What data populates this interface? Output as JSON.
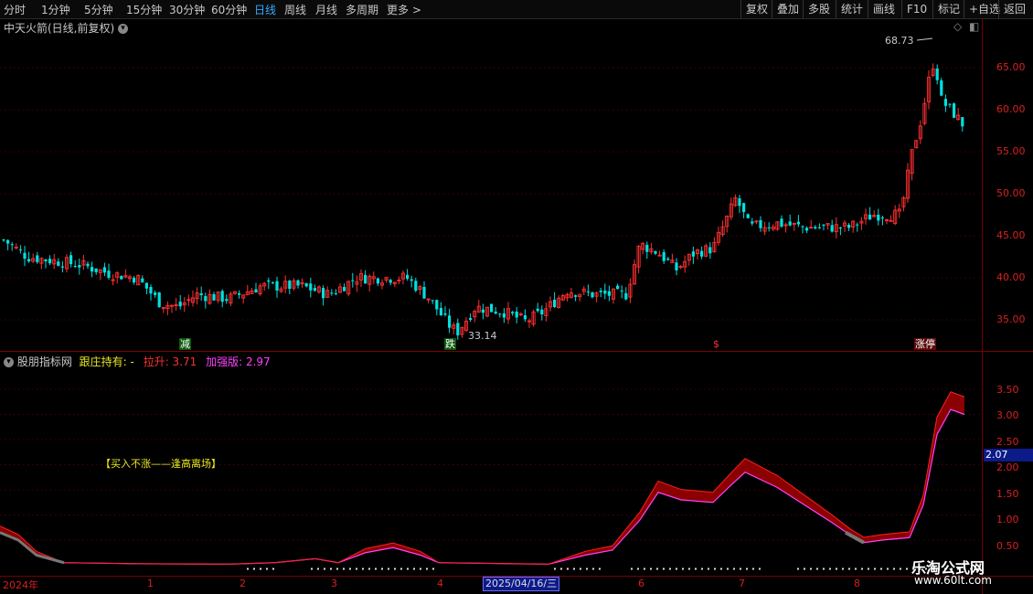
{
  "toolbar": {
    "tabs": [
      "分时",
      "1分钟",
      "5分钟",
      "15分钟",
      "30分钟",
      "60分钟",
      "日线",
      "周线",
      "月线",
      "多周期",
      "更多 >"
    ],
    "active_tab": "日线",
    "right_buttons": [
      "复权",
      "叠加",
      "多股",
      "统计",
      "画线",
      "F10",
      "标记",
      "+自选",
      "返回"
    ]
  },
  "main_chart": {
    "title": "中天火箭(日线,前复权)",
    "price_axis": [
      "65.00",
      "60.00",
      "55.00",
      "50.00",
      "45.00",
      "40.00",
      "35.00"
    ],
    "high_label": "68.73",
    "low_label": "33.14",
    "signals": [
      {
        "text": "减",
        "color": "#00c040"
      },
      {
        "text": "跌",
        "color": "#00c040"
      },
      {
        "text": "$",
        "color": "#ff3030"
      },
      {
        "text": "涨停",
        "color": "#ff4040"
      }
    ]
  },
  "indicator": {
    "name": "股朋指标网",
    "line1_label": "跟庄持有: -",
    "line2_label": "拉升: 3.71",
    "line3_label": "加强版: 2.97",
    "axis": [
      "3.50",
      "3.00",
      "2.50",
      "2.00",
      "1.50",
      "1.00",
      "0.50"
    ],
    "cursor_value": "2.07",
    "note": "【买入不涨——逢高离场】"
  },
  "date_axis": {
    "labels": [
      "2024年",
      "1",
      "2",
      "3",
      "4",
      "6",
      "7",
      "8"
    ],
    "cursor_date": "2025/04/16/三"
  },
  "watermark": {
    "line1": "乐淘公式网",
    "line2": "www.60lt.com"
  },
  "colors": {
    "up": "#ff3030",
    "down": "#00e0e0",
    "indicator_fill": "#8b0000",
    "indicator_line": "#ff40ff",
    "grid": "#7a0000"
  }
}
